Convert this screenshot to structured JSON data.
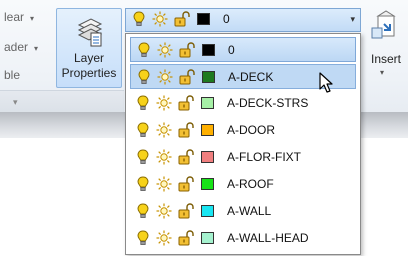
{
  "ribbon": {
    "cut_items": [
      {
        "text": "lear",
        "caret": "▾"
      },
      {
        "text": "ader",
        "caret": "▾"
      },
      {
        "text": "ble",
        "caret": ""
      }
    ],
    "footer_caret": "▾",
    "layer_properties": {
      "line1": "Layer",
      "line2": "Properties",
      "icon": "layer-properties-icon"
    },
    "insert": {
      "label": "Insert",
      "caret": "▾",
      "icon": "insert-block-icon"
    }
  },
  "layer_combo": {
    "current": {
      "name": "0",
      "color": "#000000"
    },
    "arrow": "▾"
  },
  "layers": [
    {
      "name": "0",
      "color": "#000000"
    },
    {
      "name": "A-DECK",
      "color": "#1f7a1f"
    },
    {
      "name": "A-DECK-STRS",
      "color": "#a6f0a6"
    },
    {
      "name": "A-DOOR",
      "color": "#ffb000"
    },
    {
      "name": "A-FLOR-FIXT",
      "color": "#f07f7f"
    },
    {
      "name": "A-ROOF",
      "color": "#17e317"
    },
    {
      "name": "A-WALL",
      "color": "#19e6f2"
    },
    {
      "name": "A-WALL-HEAD",
      "color": "#a5f2cf"
    }
  ],
  "colors": {
    "bulb": "#f2c500",
    "sun": "#e0a800",
    "lock": "#d49b00",
    "highlight": "#bfd9f4"
  },
  "icons": [
    "light-bulb-icon",
    "sun-freeze-icon",
    "unlock-icon",
    "color-swatch",
    "mouse-cursor-icon"
  ]
}
